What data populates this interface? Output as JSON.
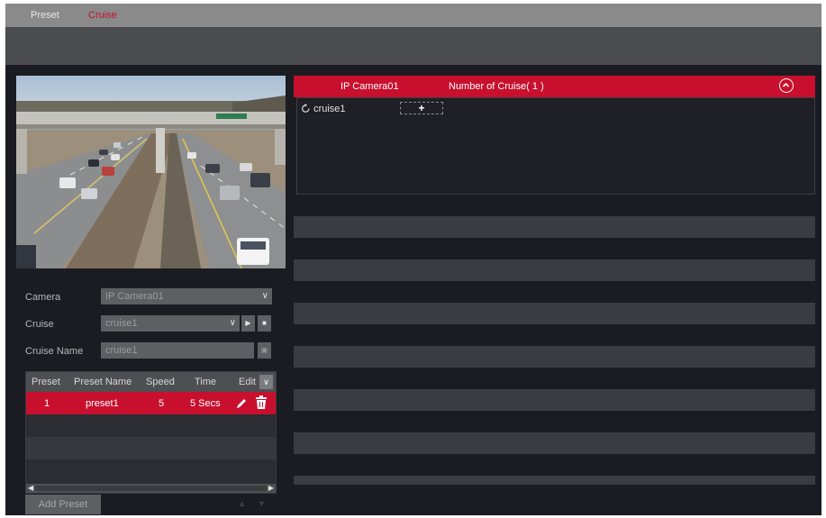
{
  "tabs": [
    {
      "label": "Preset"
    },
    {
      "label": "Cruise"
    }
  ],
  "colors": {
    "accent": "#c8102e",
    "tabbar": "#8a8a8a",
    "background": "#1b1c22"
  },
  "form": {
    "camera_label": "Camera",
    "camera_value": "IP Camera01",
    "cruise_label": "Cruise",
    "cruise_value": "cruise1",
    "cruise_name_label": "Cruise Name",
    "cruise_name_value": "cruise1"
  },
  "preset_table": {
    "headers": [
      "Preset",
      "Preset Name",
      "Speed",
      "Time",
      "Edit"
    ],
    "rows": [
      {
        "preset": "1",
        "name": "preset1",
        "speed": "5",
        "time": "5 Secs"
      }
    ]
  },
  "add_preset_label": "Add Preset",
  "cruise_panel": {
    "camera": "IP Camera01",
    "count_label": "Number of Cruise( 1 )",
    "items": [
      {
        "name": "cruise1"
      }
    ],
    "add_symbol": "+"
  },
  "icons": {
    "play": "play-icon",
    "stop": "stop-icon",
    "save": "save-icon",
    "edit": "pencil-icon",
    "delete": "trash-icon",
    "collapse": "chevron-up-circle-icon",
    "refresh": "refresh-icon"
  }
}
